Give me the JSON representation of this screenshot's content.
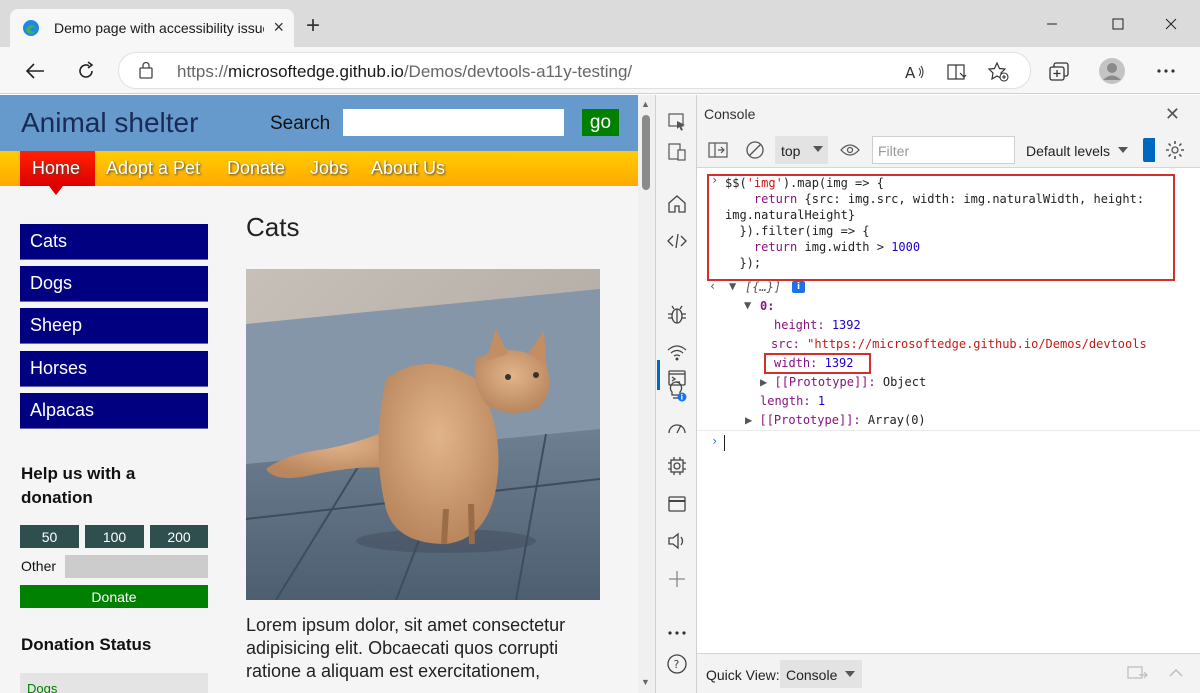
{
  "browser": {
    "tab_title": "Demo page with accessibility issues",
    "url_prefix": "https://",
    "url_host": "microsoftedge.github.io",
    "url_path": "/Demos/devtools-a11y-testing/"
  },
  "site": {
    "title": "Animal shelter",
    "search_label": "Search",
    "go_label": "go",
    "nav": [
      "Home",
      "Adopt a Pet",
      "Donate",
      "Jobs",
      "About Us"
    ],
    "sidebar": [
      "Cats",
      "Dogs",
      "Sheep",
      "Horses",
      "Alpacas"
    ],
    "help_title": "Help us with a donation",
    "amounts": [
      "50",
      "100",
      "200"
    ],
    "other_label": "Other",
    "donate_label": "Donate",
    "status_title": "Donation Status",
    "status_item": "Dogs",
    "main_heading": "Cats",
    "lorem": "Lorem ipsum dolor, sit amet consectetur adipisicing elit. Obcaecati quos corrupti ratione a aliquam est exercitationem,"
  },
  "devtools": {
    "panel_title": "Console",
    "context": "top",
    "filter_placeholder": "Filter",
    "levels": "Default levels",
    "code": {
      "l1a": "$$(",
      "l1b": "'img'",
      "l1c": ").map(img => {",
      "l2a": "return",
      "l2b": " {src: img.src, width: img.naturalWidth, height:",
      "l3": "img.naturalHeight}",
      "l4": "}).filter(img => {",
      "l5a": "return",
      "l5b": " img.width > ",
      "l5c": "1000",
      "l6": "});"
    },
    "result": {
      "summary": "[{…}]",
      "index": "0:",
      "height_key": "height:",
      "height_val": "1392",
      "src_key": "src:",
      "src_val": "\"https://microsoftedge.github.io/Demos/devtools",
      "width_key": "width:",
      "width_val": "1392",
      "proto1_key": "[[Prototype]]:",
      "proto1_val": "Object",
      "length_key": "length:",
      "length_val": "1",
      "proto2_key": "[[Prototype]]:",
      "proto2_val": "Array(0)"
    },
    "quick_view_label": "Quick View:",
    "quick_view_value": "Console"
  }
}
